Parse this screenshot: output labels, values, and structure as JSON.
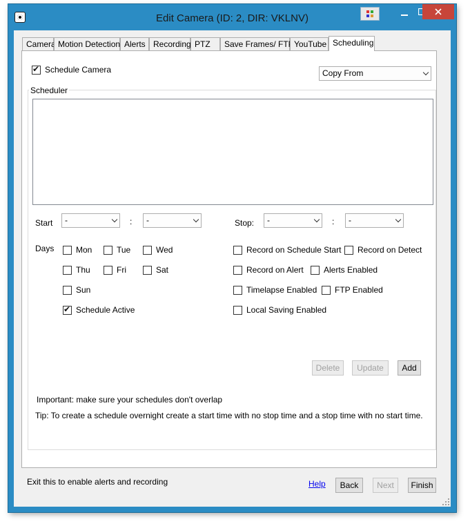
{
  "window": {
    "title": "Edit Camera (ID: 2, DIR: VKLNV)",
    "minimize": "—",
    "maximize": "☐",
    "close": "✕"
  },
  "tabs": [
    "Camera",
    "Motion Detection",
    "Alerts",
    "Recording",
    "PTZ",
    "Save Frames/ FTP",
    "YouTube",
    "Scheduling"
  ],
  "scheduling": {
    "schedule_camera": {
      "label": "Schedule Camera",
      "checked": true
    },
    "copy_from": "Copy From",
    "scheduler_label": "Scheduler",
    "start_label": "Start",
    "stop_label": "Stop:",
    "time_sep": ":",
    "start_hour": "-",
    "start_min": "-",
    "stop_hour": "-",
    "stop_min": "-",
    "days_label": "Days",
    "days": {
      "mon": "Mon",
      "tue": "Tue",
      "wed": "Wed",
      "thu": "Thu",
      "fri": "Fri",
      "sat": "Sat",
      "sun": "Sun"
    },
    "schedule_active": "Schedule Active",
    "options": {
      "record_on_schedule_start": "Record on Schedule Start",
      "record_on_detect": "Record on Detect",
      "record_on_alert": "Record on Alert",
      "alerts_enabled": "Alerts Enabled",
      "timelapse_enabled": "Timelapse Enabled",
      "ftp_enabled": "FTP Enabled",
      "local_saving_enabled": "Local Saving Enabled"
    },
    "buttons": {
      "delete": "Delete",
      "update": "Update",
      "add": "Add"
    },
    "important": "Important: make sure your schedules don't overlap",
    "tip": "Tip: To create a schedule overnight create a start time with no stop time and a stop time with no start time."
  },
  "footer": {
    "message": "Exit this to enable alerts and recording",
    "help": "Help",
    "back": "Back",
    "next": "Next",
    "finish": "Finish"
  },
  "colors": {
    "titlebar": "#2b8cc4",
    "close": "#c7453a"
  }
}
